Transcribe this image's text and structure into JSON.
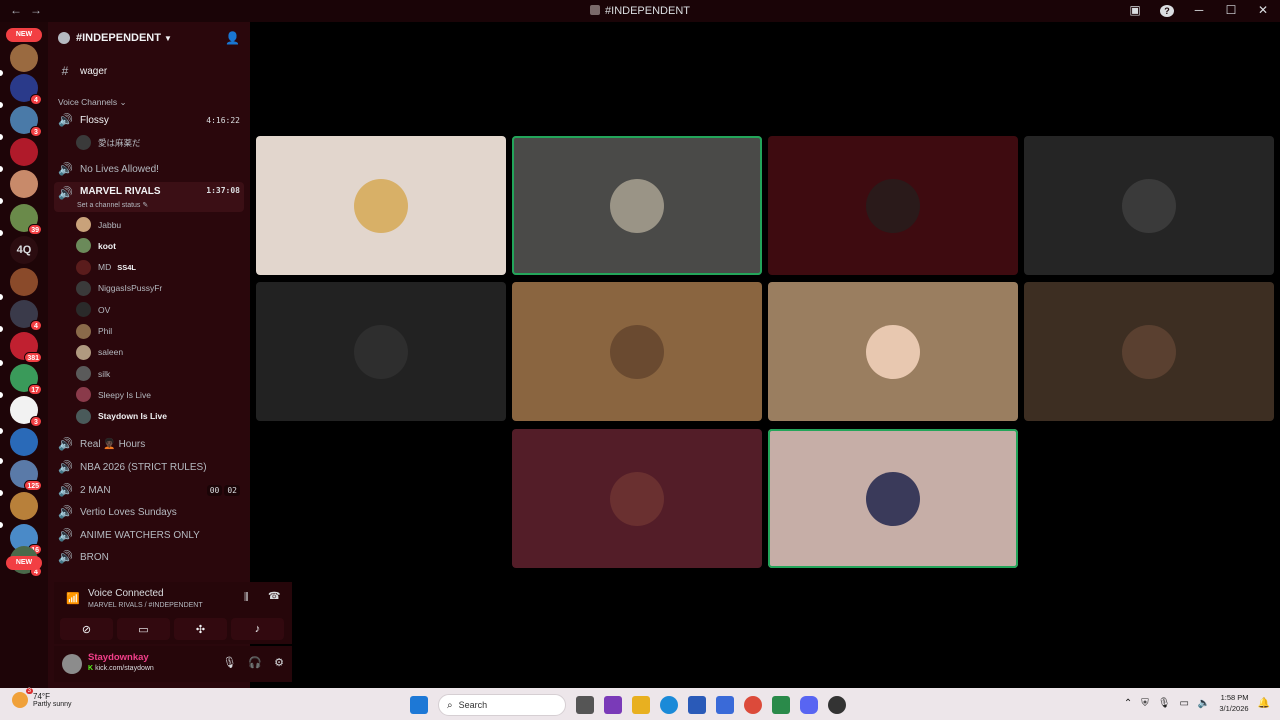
{
  "window": {
    "title": "#INDEPENDENT",
    "back": "←",
    "forward": "→",
    "controls": {
      "minimize": "─",
      "maximize": "☐",
      "close": "✕",
      "help": "?"
    }
  },
  "server_rail": {
    "new_top": "NEW",
    "new_bottom": "NEW",
    "text_server": "4Q",
    "badges": [
      "4",
      "3",
      "39",
      "4",
      "381",
      "17",
      "3",
      "125",
      "16",
      "4"
    ]
  },
  "guild": {
    "name": "#INDEPENDENT"
  },
  "channels": {
    "wager": "wager",
    "voice_category": "Voice Channels",
    "flossy": {
      "name": "Flossy",
      "timer": "4:16:22",
      "member": "愛は麻薬だ"
    },
    "no_lives": "No Lives Allowed!",
    "marvel": {
      "name": "MARVEL RIVALS",
      "timer": "1:37:08",
      "status_prompt": "Set a channel status",
      "members": [
        {
          "name": "Jabbu",
          "color": "#c9a27a"
        },
        {
          "name": "koot",
          "color": "#6b8a5a"
        },
        {
          "name": "MD",
          "color": "#5a1c1c",
          "tag": "SS4L"
        },
        {
          "name": "NiggasIsPussyFr",
          "color": "#3a3a3a"
        },
        {
          "name": "OV",
          "color": "#2a2a2a"
        },
        {
          "name": "Phil",
          "color": "#8a6a4a"
        },
        {
          "name": "saleen",
          "color": "#b09a80"
        },
        {
          "name": "silk",
          "color": "#5a5a5a"
        },
        {
          "name": "Sleepy Is Live",
          "color": "#8a3a4a"
        },
        {
          "name": "Staydown Is Live",
          "color": "#4a5a5a"
        }
      ]
    },
    "real_hours": "Real 🧑🏿‍🦱 Hours",
    "nba": "NBA 2026 (STRICT RULES)",
    "two_man": {
      "name": "2 MAN",
      "c1": "00",
      "c2": "02"
    },
    "vertio": "Vertio Loves Sundays",
    "anime": "ANIME WATCHERS ONLY",
    "bron": "BRON"
  },
  "voice": {
    "title": "Voice Connected",
    "subtitle": "MARVEL RIVALS / #INDEPENDENT"
  },
  "user": {
    "name": "Staydownkay",
    "status": "kick.com/staydown"
  },
  "tiles": [
    {
      "bg": "#e2d6cd",
      "avatar": "#d8b067",
      "speaking": false
    },
    {
      "bg": "#4a4a48",
      "avatar": "#9a9486",
      "speaking": true
    },
    {
      "bg": "#3e0b10",
      "avatar": "#2a1a1a",
      "speaking": false
    },
    {
      "bg": "#252525",
      "avatar": "#3a3a3a",
      "speaking": false
    },
    {
      "bg": "#222222",
      "avatar": "#2e2e2e",
      "speaking": false
    },
    {
      "bg": "#8a6540",
      "avatar": "#6a4a30",
      "speaking": false
    },
    {
      "bg": "#9a7e60",
      "avatar": "#e8c8b0",
      "speaking": false
    },
    {
      "bg": "#3d2e22",
      "avatar": "#5a4030",
      "speaking": false
    },
    {
      "bg": "#531d28",
      "avatar": "#6a3030",
      "speaking": false
    },
    {
      "bg": "#c6aea7",
      "avatar": "#3a3a5a",
      "speaking": true
    }
  ],
  "taskbar": {
    "temp": "74°F",
    "weather": "Partly sunny",
    "weather_badge": "3",
    "search": "Search",
    "time": "1:58 PM",
    "date": "3/1/2026"
  }
}
